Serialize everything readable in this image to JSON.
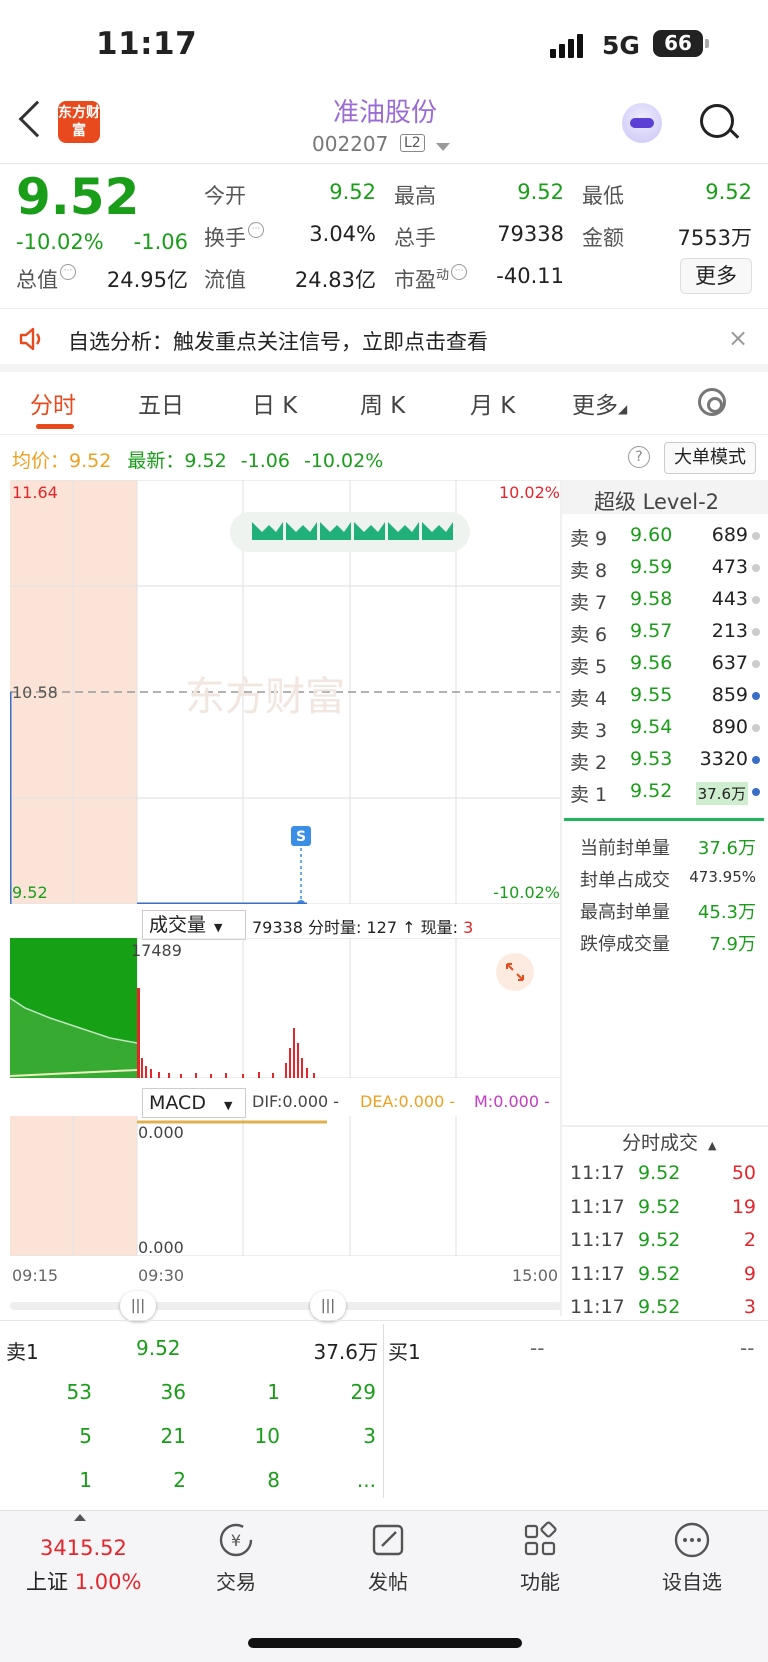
{
  "status": {
    "time": "11:17",
    "network": "5G",
    "battery": "66"
  },
  "header": {
    "logo": "东方财富",
    "name": "准油股份",
    "code": "002207",
    "level_tag": "L2"
  },
  "quote": {
    "price": "9.52",
    "change_pct": "-10.02%",
    "change": "-1.06",
    "open_label": "今开",
    "open": "9.52",
    "high_label": "最高",
    "high": "9.52",
    "low_label": "最低",
    "low": "9.52",
    "turnover_label": "换手",
    "turnover": "3.04%",
    "volume_label": "总手",
    "volume": "79338",
    "amount_label": "金额",
    "amount": "7553万",
    "mktcap_label": "总值",
    "mktcap": "24.95亿",
    "float_label": "流值",
    "float": "24.83亿",
    "pe_label": "市盈",
    "pe_sup": "动",
    "pe": "-40.11",
    "more": "更多"
  },
  "notice": {
    "text": "自选分析：触发重点关注信号，立即点击查看",
    "close": "×"
  },
  "tabs": [
    {
      "label": "分时"
    },
    {
      "label": "五日"
    },
    {
      "label": "日 K"
    },
    {
      "label": "周 K"
    },
    {
      "label": "月 K"
    },
    {
      "label": "更多"
    }
  ],
  "info": {
    "avg_label": "均价：",
    "avg": "9.52",
    "latest_label": "最新：",
    "latest": "9.52",
    "chg": "-1.06",
    "pct": "-10.02%",
    "help": "?",
    "big_mode": "大单模式"
  },
  "chart": {
    "y_top": "11.64",
    "y_mid": "10.58",
    "y_bot": "9.52",
    "pct_top": "10.02%",
    "pct_bot": "-10.02%",
    "watermark": "东方财富",
    "marker": "S",
    "times": [
      "09:15",
      "09:30",
      "15:00"
    ]
  },
  "chart_data": {
    "type": "line",
    "x": [
      "09:15",
      "09:30",
      "15:00"
    ],
    "ylim": [
      9.52,
      11.64
    ],
    "series": [
      {
        "values": [
          9.52,
          9.52,
          9.52
        ]
      }
    ]
  },
  "volume": {
    "selector": "成交量",
    "summary": "79338 分时量: 127 ↑ 现量:",
    "current": "3",
    "max": "17489"
  },
  "macd": {
    "selector": "MACD",
    "dif": "DIF:0.000 -",
    "dea": "DEA:0.000 -",
    "m": "M:0.000 -",
    "top": "0.000",
    "bot": "0.000"
  },
  "orderbook": {
    "title": "超级 Level-2",
    "asks": [
      {
        "label": "卖 9",
        "price": "9.60",
        "vol": "689",
        "dot": "#cccccc"
      },
      {
        "label": "卖 8",
        "price": "9.59",
        "vol": "473",
        "dot": "#cccccc"
      },
      {
        "label": "卖 7",
        "price": "9.58",
        "vol": "443",
        "dot": "#cccccc"
      },
      {
        "label": "卖 6",
        "price": "9.57",
        "vol": "213",
        "dot": "#cccccc"
      },
      {
        "label": "卖 5",
        "price": "9.56",
        "vol": "637",
        "dot": "#cccccc"
      },
      {
        "label": "卖 4",
        "price": "9.55",
        "vol": "859",
        "dot": "#3a6fc8"
      },
      {
        "label": "卖 3",
        "price": "9.54",
        "vol": "890",
        "dot": "#cccccc"
      },
      {
        "label": "卖 2",
        "price": "9.53",
        "vol": "3320",
        "dot": "#3a6fc8"
      },
      {
        "label": "卖 1",
        "price": "9.52",
        "vol": "37.6万",
        "dot": "#3a6fc8"
      }
    ],
    "seal": [
      {
        "label": "当前封单量",
        "value": "37.6万"
      },
      {
        "label": "封单占成交",
        "value": "473.95%"
      },
      {
        "label": "最高封单量",
        "value": "45.3万"
      },
      {
        "label": "跌停成交量",
        "value": "7.9万"
      }
    ]
  },
  "trades": {
    "title": "分时成交",
    "rows": [
      {
        "time": "11:17",
        "price": "9.52",
        "vol": "50"
      },
      {
        "time": "11:17",
        "price": "9.52",
        "vol": "19"
      },
      {
        "time": "11:17",
        "price": "9.52",
        "vol": "2"
      },
      {
        "time": "11:17",
        "price": "9.52",
        "vol": "9"
      },
      {
        "time": "11:17",
        "price": "9.52",
        "vol": "3"
      }
    ]
  },
  "book": {
    "sell_label": "卖1",
    "sell_price": "9.52",
    "sell_vol": "37.6万",
    "buy_label": "买1",
    "buy_price": "--",
    "buy_vol": "--",
    "grid": [
      [
        "53",
        "36",
        "1",
        "29"
      ],
      [
        "5",
        "21",
        "10",
        "3"
      ],
      [
        "1",
        "2",
        "8",
        "..."
      ]
    ]
  },
  "footer": {
    "index_value": "3415.52",
    "index_name": "上证",
    "index_pct": "1.00%",
    "items": [
      "交易",
      "发帖",
      "功能",
      "设自选"
    ]
  }
}
